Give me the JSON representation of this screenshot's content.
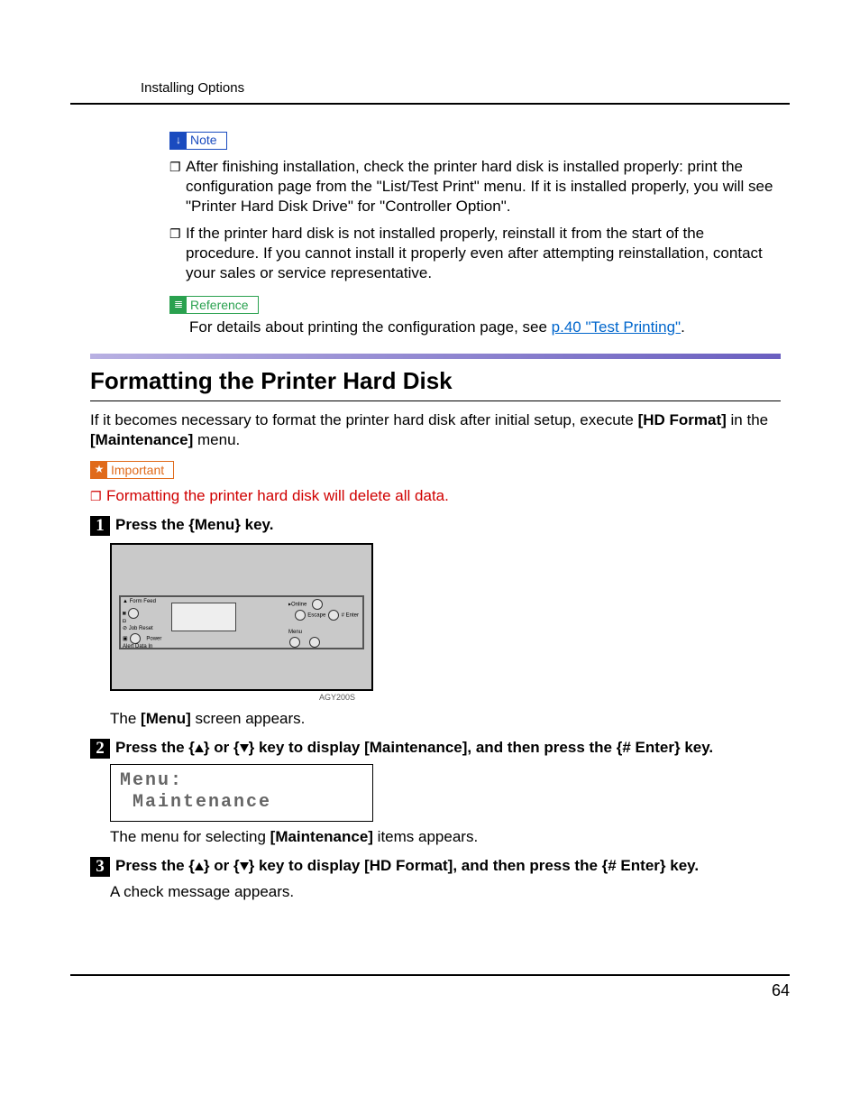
{
  "header": {
    "running": "Installing Options"
  },
  "tags": {
    "note": "Note",
    "reference": "Reference",
    "important": "Important"
  },
  "noteItems": [
    "After finishing installation, check the printer hard disk is installed properly: print the configuration page from the \"List/Test Print\" menu. If it is installed properly, you will see \"Printer Hard Disk Drive\" for \"Controller Option\".",
    "If the printer hard disk is not installed properly, reinstall it from the start of the procedure. If you cannot install it properly even after attempting reinstallation, contact your sales or service representative."
  ],
  "reference": {
    "lead": "For details about printing the configuration page, see ",
    "linkText": "p.40 \"Test Printing\"",
    "tail": "."
  },
  "section": {
    "title": "Formatting the Printer Hard Disk",
    "intro1": "If it becomes necessary to format the printer hard disk after initial setup, execute ",
    "intro_bold1": "[HD Format]",
    "intro_mid": " in the ",
    "intro_bold2": "[Maintenance]",
    "intro_tail": " menu."
  },
  "importantItems": [
    "Formatting the printer hard disk will delete all data."
  ],
  "steps": [
    {
      "line": {
        "p1": "Press the ",
        "k1": "{Menu}",
        "p2": " key."
      },
      "figureId": "AGY200S",
      "after_lead": "The ",
      "after_bold": "[Menu]",
      "after_tail": " screen appears."
    },
    {
      "line": {
        "p1": "Press the ",
        "k1": "{",
        "k1b": "}",
        "p2": " or ",
        "k2": "{",
        "k2b": "}",
        "p3": " key to display ",
        "b1": "[Maintenance]",
        "p4": ", and then press the ",
        "k3": "{# Enter}",
        "p5": " key."
      },
      "lcd": "Menu:\n Maintenance",
      "after_lead": "The menu for selecting ",
      "after_bold": "[Maintenance]",
      "after_tail": " items appears."
    },
    {
      "line": {
        "p1": "Press the ",
        "k1": "{",
        "k1b": "}",
        "p2": " or ",
        "k2": "{",
        "k2b": "}",
        "p3": " key to display ",
        "b1": "[HD Format]",
        "p4": ", and then press the ",
        "k3": "{# Enter}",
        "p5": " key."
      },
      "after_plain": "A check message appears."
    }
  ],
  "panelLabels": {
    "formFeed": "Form Feed",
    "jobReset": "Job Reset",
    "power": "Power",
    "alert": "Alert",
    "dataIn": "Data In",
    "online": "Online",
    "escape": "Escape",
    "enter": "# Enter",
    "menu": "Menu"
  },
  "pageNumber": "64"
}
